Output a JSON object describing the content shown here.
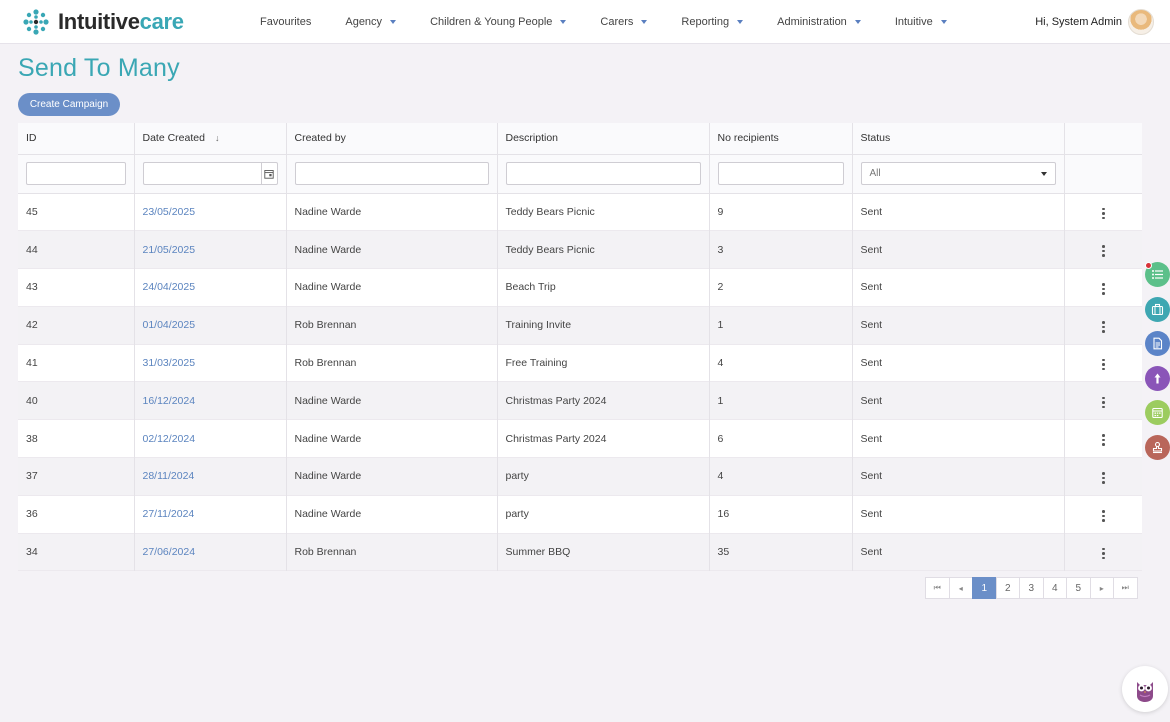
{
  "app": {
    "logo_text_a": "Intuitive",
    "logo_text_b": "care",
    "accent_color": "#3aa7b4",
    "brand_blue": "#6b8fc8"
  },
  "nav": {
    "items": [
      {
        "label": "Favourites",
        "dropdown": false
      },
      {
        "label": "Agency",
        "dropdown": true
      },
      {
        "label": "Children & Young People",
        "dropdown": true
      },
      {
        "label": "Carers",
        "dropdown": true
      },
      {
        "label": "Reporting",
        "dropdown": true
      },
      {
        "label": "Administration",
        "dropdown": true
      },
      {
        "label": "Intuitive",
        "dropdown": true
      }
    ],
    "user_greeting": "Hi, System Admin"
  },
  "page": {
    "title": "Send To Many",
    "create_button": "Create Campaign"
  },
  "table": {
    "columns": [
      "ID",
      "Date Created",
      "Created by",
      "Description",
      "No recipients",
      "Status",
      ""
    ],
    "sort_indicator": "↓",
    "status_filter": "All",
    "rows": [
      {
        "id": "45",
        "date": "23/05/2025",
        "by": "Nadine Warde",
        "desc": "Teddy Bears Picnic",
        "recipients": "9",
        "status": "Sent"
      },
      {
        "id": "44",
        "date": "21/05/2025",
        "by": "Nadine Warde",
        "desc": "Teddy Bears Picnic",
        "recipients": "3",
        "status": "Sent"
      },
      {
        "id": "43",
        "date": "24/04/2025",
        "by": "Nadine Warde",
        "desc": "Beach Trip",
        "recipients": "2",
        "status": "Sent"
      },
      {
        "id": "42",
        "date": "01/04/2025",
        "by": "Rob Brennan",
        "desc": "Training Invite",
        "recipients": "1",
        "status": "Sent"
      },
      {
        "id": "41",
        "date": "31/03/2025",
        "by": "Rob Brennan",
        "desc": "Free Training",
        "recipients": "4",
        "status": "Sent"
      },
      {
        "id": "40",
        "date": "16/12/2024",
        "by": "Nadine Warde",
        "desc": "Christmas Party 2024",
        "recipients": "1",
        "status": "Sent"
      },
      {
        "id": "38",
        "date": "02/12/2024",
        "by": "Nadine Warde",
        "desc": "Christmas Party 2024",
        "recipients": "6",
        "status": "Sent"
      },
      {
        "id": "37",
        "date": "28/11/2024",
        "by": "Nadine Warde",
        "desc": "party",
        "recipients": "4",
        "status": "Sent"
      },
      {
        "id": "36",
        "date": "27/11/2024",
        "by": "Nadine Warde",
        "desc": "party",
        "recipients": "16",
        "status": "Sent"
      },
      {
        "id": "34",
        "date": "27/06/2024",
        "by": "Rob Brennan",
        "desc": "Summer BBQ",
        "recipients": "35",
        "status": "Sent"
      }
    ]
  },
  "pagination": {
    "pages": [
      "1",
      "2",
      "3",
      "4",
      "5"
    ],
    "current": "1"
  },
  "dock": {
    "buttons": [
      {
        "icon": "list-icon",
        "color": "#5cc08a",
        "notification": true
      },
      {
        "icon": "briefcase-icon",
        "color": "#3ea7b2",
        "notification": false
      },
      {
        "icon": "document-icon",
        "color": "#5b84c8",
        "notification": false
      },
      {
        "icon": "pointer-icon",
        "color": "#8a55b8",
        "notification": false
      },
      {
        "icon": "calendar-icon",
        "color": "#9ccc5f",
        "notification": false
      },
      {
        "icon": "stamp-icon",
        "color": "#b9665a",
        "notification": false
      }
    ]
  }
}
